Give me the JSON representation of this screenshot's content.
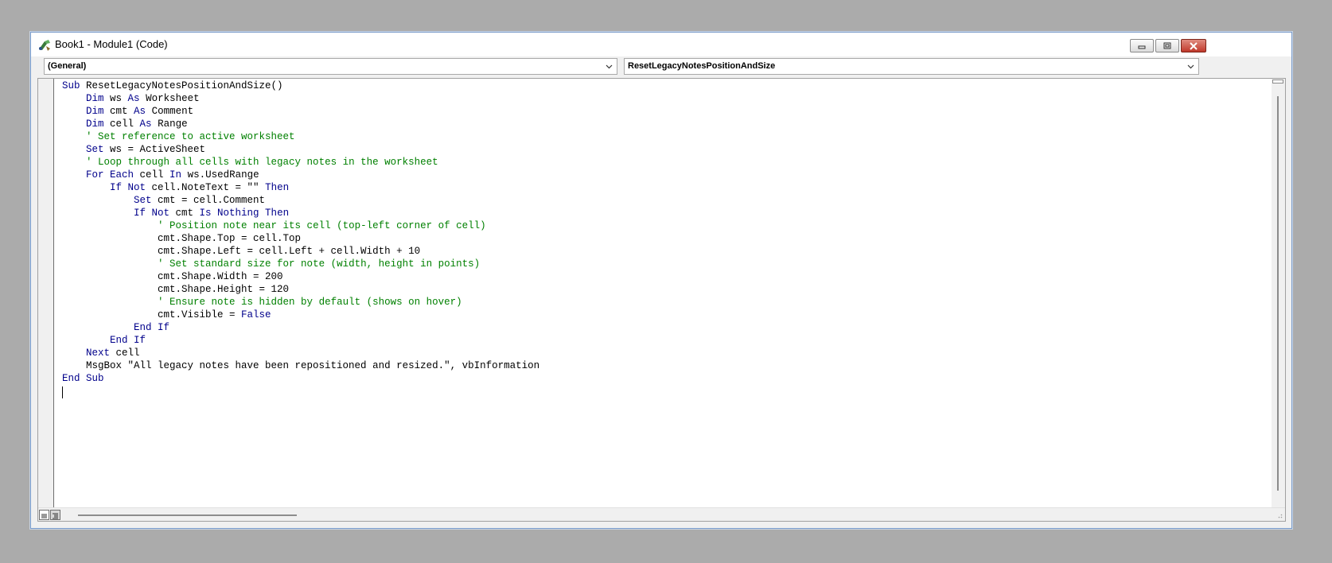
{
  "window": {
    "title": "Book1 - Module1 (Code)",
    "icon": "vba-module-icon"
  },
  "controls": {
    "minimize": "minimize-icon",
    "maximize": "maximize-icon",
    "close": "close-icon"
  },
  "object_dropdown": {
    "value": "(General)"
  },
  "procedure_dropdown": {
    "value": "ResetLegacyNotesPositionAndSize"
  },
  "colors": {
    "keyword": "#00008b",
    "comment": "#008000",
    "text": "#000000"
  },
  "code": {
    "lines": [
      [
        {
          "t": "Sub ",
          "c": "kw"
        },
        {
          "t": "ResetLegacyNotesPositionAndSize()",
          "c": ""
        }
      ],
      [
        {
          "t": "    ",
          "c": ""
        },
        {
          "t": "Dim",
          "c": "kw"
        },
        {
          "t": " ws ",
          "c": ""
        },
        {
          "t": "As",
          "c": "kw"
        },
        {
          "t": " Worksheet",
          "c": ""
        }
      ],
      [
        {
          "t": "    ",
          "c": ""
        },
        {
          "t": "Dim",
          "c": "kw"
        },
        {
          "t": " cmt ",
          "c": ""
        },
        {
          "t": "As",
          "c": "kw"
        },
        {
          "t": " Comment",
          "c": ""
        }
      ],
      [
        {
          "t": "    ",
          "c": ""
        },
        {
          "t": "Dim",
          "c": "kw"
        },
        {
          "t": " cell ",
          "c": ""
        },
        {
          "t": "As",
          "c": "kw"
        },
        {
          "t": " Range",
          "c": ""
        }
      ],
      [
        {
          "t": "    ",
          "c": ""
        },
        {
          "t": "' Set reference to active worksheet",
          "c": "cm"
        }
      ],
      [
        {
          "t": "    ",
          "c": ""
        },
        {
          "t": "Set",
          "c": "kw"
        },
        {
          "t": " ws = ActiveSheet",
          "c": ""
        }
      ],
      [
        {
          "t": "    ",
          "c": ""
        },
        {
          "t": "' Loop through all cells with legacy notes in the worksheet",
          "c": "cm"
        }
      ],
      [
        {
          "t": "    ",
          "c": ""
        },
        {
          "t": "For Each",
          "c": "kw"
        },
        {
          "t": " cell ",
          "c": ""
        },
        {
          "t": "In",
          "c": "kw"
        },
        {
          "t": " ws.UsedRange",
          "c": ""
        }
      ],
      [
        {
          "t": "        ",
          "c": ""
        },
        {
          "t": "If Not",
          "c": "kw"
        },
        {
          "t": " cell.NoteText = \"\" ",
          "c": ""
        },
        {
          "t": "Then",
          "c": "kw"
        }
      ],
      [
        {
          "t": "            ",
          "c": ""
        },
        {
          "t": "Set",
          "c": "kw"
        },
        {
          "t": " cmt = cell.Comment",
          "c": ""
        }
      ],
      [
        {
          "t": "            ",
          "c": ""
        },
        {
          "t": "If Not",
          "c": "kw"
        },
        {
          "t": " cmt ",
          "c": ""
        },
        {
          "t": "Is Nothing Then",
          "c": "kw"
        }
      ],
      [
        {
          "t": "                ",
          "c": ""
        },
        {
          "t": "' Position note near its cell (top-left corner of cell)",
          "c": "cm"
        }
      ],
      [
        {
          "t": "                cmt.Shape.Top = cell.Top",
          "c": ""
        }
      ],
      [
        {
          "t": "                cmt.Shape.Left = cell.Left + cell.Width + 10",
          "c": ""
        }
      ],
      [
        {
          "t": "                ",
          "c": ""
        },
        {
          "t": "' Set standard size for note (width, height in points)",
          "c": "cm"
        }
      ],
      [
        {
          "t": "                cmt.Shape.Width = 200",
          "c": ""
        }
      ],
      [
        {
          "t": "                cmt.Shape.Height = 120",
          "c": ""
        }
      ],
      [
        {
          "t": "                ",
          "c": ""
        },
        {
          "t": "' Ensure note is hidden by default (shows on hover)",
          "c": "cm"
        }
      ],
      [
        {
          "t": "                cmt.Visible = ",
          "c": ""
        },
        {
          "t": "False",
          "c": "kw"
        }
      ],
      [
        {
          "t": "            ",
          "c": ""
        },
        {
          "t": "End If",
          "c": "kw"
        }
      ],
      [
        {
          "t": "        ",
          "c": ""
        },
        {
          "t": "End If",
          "c": "kw"
        }
      ],
      [
        {
          "t": "    ",
          "c": ""
        },
        {
          "t": "Next",
          "c": "kw"
        },
        {
          "t": " cell",
          "c": ""
        }
      ],
      [
        {
          "t": "    MsgBox \"All legacy notes have been repositioned and resized.\", vbInformation",
          "c": ""
        }
      ],
      [
        {
          "t": "End Sub",
          "c": "kw"
        }
      ]
    ]
  }
}
